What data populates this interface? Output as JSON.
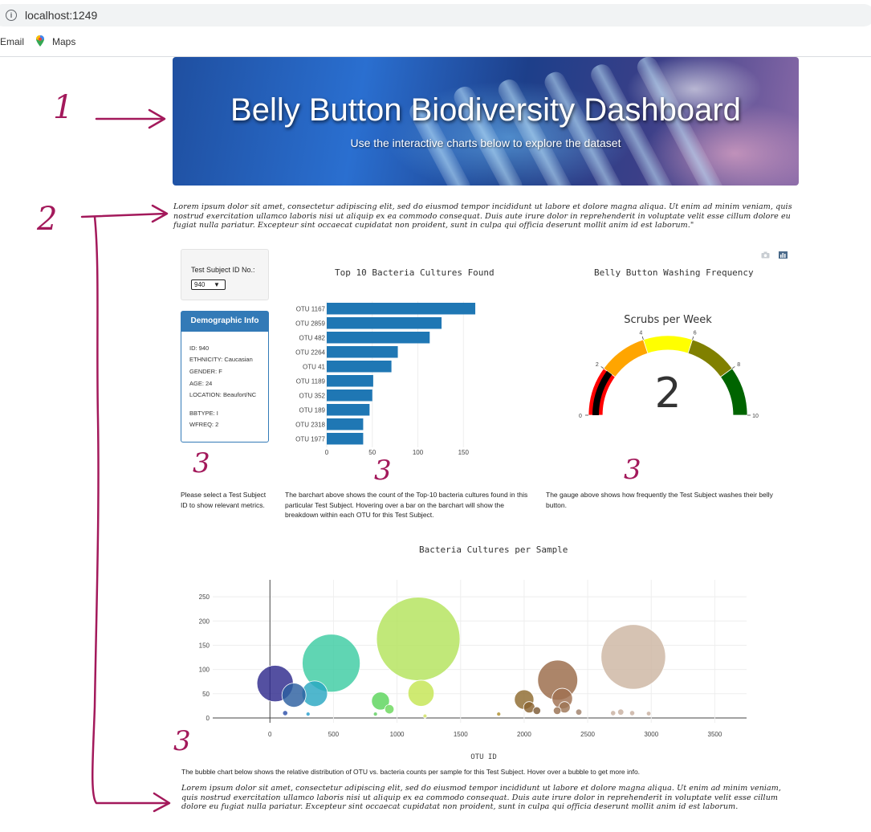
{
  "browser": {
    "url": "localhost:1249",
    "bookmarks": [
      "Gmail",
      "Maps"
    ],
    "gmail_visible": "Email"
  },
  "hero": {
    "title": "Belly Button Biodiversity Dashboard",
    "subtitle": "Use the interactive charts below to explore the dataset"
  },
  "intro_text": "Lorem ipsum dolor sit amet, consectetur adipiscing elit, sed do eiusmod tempor incididunt ut labore et dolore magna aliqua. Ut enim ad minim veniam, quis nostrud exercitation ullamco laboris nisi ut aliquip ex ea commodo consequat. Duis aute irure dolor in reprehenderit in voluptate velit esse cillum dolore eu fugiat nulla pariatur. Excepteur sint occaecat cupidatat non proident, sunt in culpa qui officia deserunt mollit anim id est laborum.\"",
  "footer_text": "Lorem ipsum dolor sit amet, consectetur adipiscing elit, sed do eiusmod tempor incididunt ut labore et dolore magna aliqua. Ut enim ad minim veniam, quis nostrud exercitation ullamco laboris nisi ut aliquip ex ea commodo consequat. Duis aute irure dolor in reprehenderit in voluptate velit esse cillum dolore eu fugiat nulla pariatur. Excepteur sint occaecat cupidatat non proident, sunt in culpa qui officia deserunt mollit anim id est laborum.",
  "annotations": [
    "1",
    "2",
    "3"
  ],
  "selector": {
    "label": "Test Subject ID No.:",
    "value": "940"
  },
  "demographics": {
    "title": "Demographic Info",
    "rows": [
      "ID: 940",
      "ETHNICITY: Caucasian",
      "GENDER: F",
      "AGE: 24",
      "LOCATION: Beaufort/NC",
      "BBTYPE: I",
      "WFREQ: 2"
    ]
  },
  "captions": {
    "selector": "Please select a Test Subject ID to show relevant metrics.",
    "bar": "The barchart above shows the count of the Top-10 bacteria cultures found in this particular Test Subject. Hovering over a bar on the barchart will show the breakdown within each OTU for this Test Subject.",
    "gauge": "The gauge above shows how frequently the Test Subject washes their belly button.",
    "bubble": "The bubble chart below shows the relative distribution of OTU vs. bacteria counts per sample for this Test Subject. Hover over a bubble to get more info."
  },
  "colors": {
    "bar": "#1f77b4",
    "panel_border": "#337ab7",
    "annotation": "#a3195b"
  },
  "chart_data": [
    {
      "type": "bar",
      "orientation": "horizontal",
      "title": "Top 10 Bacteria Cultures Found",
      "categories": [
        "OTU 1167",
        "OTU 2859",
        "OTU 482",
        "OTU 2264",
        "OTU 41",
        "OTU 1189",
        "OTU 352",
        "OTU 189",
        "OTU 2318",
        "OTU 1977"
      ],
      "values": [
        163,
        126,
        113,
        78,
        71,
        51,
        50,
        47,
        40,
        40
      ],
      "xticks": [
        0,
        50,
        100,
        150
      ],
      "xlim": [
        0,
        170
      ]
    },
    {
      "type": "gauge",
      "title": "Belly Button Washing Frequency",
      "subtitle": "Scrubs per Week",
      "value": 2,
      "range": [
        0,
        10
      ],
      "ticks": [
        0,
        2,
        4,
        6,
        8,
        10
      ],
      "bands": [
        {
          "range": [
            0,
            2
          ],
          "color": "#ff0000"
        },
        {
          "range": [
            2,
            4
          ],
          "color": "#ffa500"
        },
        {
          "range": [
            4,
            6
          ],
          "color": "#ffff00"
        },
        {
          "range": [
            6,
            8
          ],
          "color": "#808000"
        },
        {
          "range": [
            8,
            10
          ],
          "color": "#006400"
        }
      ],
      "bar_color": "#000000"
    },
    {
      "type": "scatter",
      "mode": "bubble",
      "title": "Bacteria Cultures per Sample",
      "xlabel": "OTU ID",
      "xlim": [
        -450,
        3750
      ],
      "ylim": [
        -10,
        285
      ],
      "xticks": [
        0,
        500,
        1000,
        1500,
        2000,
        2500,
        3000,
        3500
      ],
      "yticks": [
        0,
        50,
        100,
        150,
        200,
        250
      ],
      "points": [
        {
          "x": 41,
          "y": 71,
          "color": "#2e2a8c"
        },
        {
          "x": 189,
          "y": 47,
          "color": "#2c5fa0"
        },
        {
          "x": 352,
          "y": 50,
          "color": "#2aa7c2"
        },
        {
          "x": 482,
          "y": 113,
          "color": "#3dcca2"
        },
        {
          "x": 870,
          "y": 35,
          "color": "#5ad45a"
        },
        {
          "x": 940,
          "y": 18,
          "color": "#6ad85a"
        },
        {
          "x": 1167,
          "y": 163,
          "color": "#b3e35b"
        },
        {
          "x": 1189,
          "y": 51,
          "color": "#c4e553"
        },
        {
          "x": 2000,
          "y": 38,
          "color": "#8d6a2e"
        },
        {
          "x": 2040,
          "y": 22,
          "color": "#8a6330"
        },
        {
          "x": 2100,
          "y": 15,
          "color": "#7d5a34"
        },
        {
          "x": 2264,
          "y": 78,
          "color": "#9a6a48"
        },
        {
          "x": 2300,
          "y": 40,
          "color": "#a07050"
        },
        {
          "x": 2318,
          "y": 22,
          "color": "#9e7555"
        },
        {
          "x": 2260,
          "y": 15,
          "color": "#987050"
        },
        {
          "x": 2859,
          "y": 126,
          "color": "#cdb6a2"
        },
        {
          "x": 120,
          "y": 10,
          "color": "#2c4fa8"
        },
        {
          "x": 300,
          "y": 8,
          "color": "#2aa0d0"
        },
        {
          "x": 830,
          "y": 8,
          "color": "#60d060"
        },
        {
          "x": 1220,
          "y": 4,
          "color": "#d0e060"
        },
        {
          "x": 1800,
          "y": 8,
          "color": "#b09030"
        },
        {
          "x": 2430,
          "y": 12,
          "color": "#a0806a"
        },
        {
          "x": 2700,
          "y": 10,
          "color": "#c8b0a0"
        },
        {
          "x": 2760,
          "y": 12,
          "color": "#c8b0a0"
        },
        {
          "x": 2850,
          "y": 10,
          "color": "#c8b0a0"
        },
        {
          "x": 2980,
          "y": 9,
          "color": "#c8b0a0"
        }
      ],
      "sizes": [
        71,
        47,
        50,
        113,
        35,
        18,
        163,
        51,
        38,
        22,
        15,
        78,
        40,
        22,
        15,
        126,
        10,
        8,
        8,
        4,
        8,
        12,
        10,
        12,
        10,
        9
      ]
    }
  ]
}
